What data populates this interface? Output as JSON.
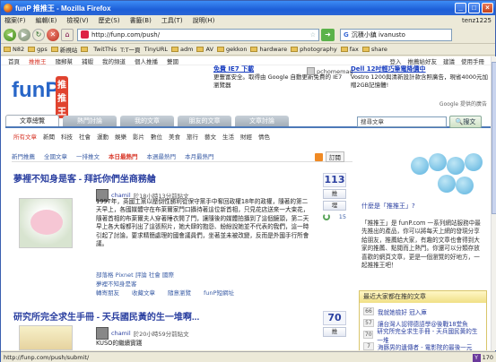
{
  "window": {
    "title": "funP 推推王 - Mozilla Firefox",
    "min": "_",
    "max": "□",
    "close": "×"
  },
  "menu": {
    "items": [
      "檔案(F)",
      "編輯(E)",
      "檢視(V)",
      "歷史(S)",
      "書籤(B)",
      "工具(T)",
      "說明(H)"
    ],
    "user": "tenz1225"
  },
  "nav": {
    "url": "http://funp.com/push/",
    "search_text": "沉積小鎮 ivanusto",
    "search_engine": "G"
  },
  "bookmarks": [
    "N82",
    "gps",
    "新視站",
    "",
    "TwitThis",
    "T:T一頁",
    "TinyURL",
    "adm",
    "AV",
    "gekkon",
    "hardware",
    "photography",
    "fax",
    "share"
  ],
  "site": {
    "topnav": [
      "首頁",
      "推推王",
      "隨郵幫",
      "捕蝦",
      "我的頻道",
      "個人推播",
      "雙國"
    ],
    "topnav_right": [
      "登入",
      "推薦給好友",
      "建議",
      "使用手冊"
    ],
    "logo_text": "funP",
    "logo_cn": "推推王"
  },
  "ads": {
    "ad1_link": "免費 IE7 下載",
    "ad1_text": "更豐富安全。取得由 Google 自動更新免費的 IE7 瀏覽器",
    "pc_badge": "pchomemag",
    "ad2_link": "Dell 12吋輕巧筆電降價中",
    "ad2_text": "Vostro 1200與清新設計款含照廣告，現省4000元加贈2GB記憶體!",
    "google": "Google 提供的廣告"
  },
  "tabs": [
    "文章總覽",
    "熱門討論",
    "我的文章",
    "朋友的文章",
    "文章討論"
  ],
  "site_search": {
    "placeholder": "搜尋文章",
    "button": "搜文"
  },
  "categories": [
    "所有文章",
    "新聞",
    "科技",
    "社會",
    "運動",
    "娛樂",
    "影片",
    "數位",
    "美食",
    "旅行",
    "藝文",
    "生活",
    "財經",
    "情色"
  ],
  "subtabs": [
    "新門推薦",
    "全國文章",
    "一排推文",
    "本日最熱門",
    "本週最熱門",
    "本月最熱門"
  ],
  "subscribe": "訂閱",
  "stories": [
    {
      "title": "夢裡不知身是客 - 拜託你們坐商務艙",
      "user": "chamil",
      "time": "於18小時13分前貼文",
      "excerpt": "1997年，英國工黨以壓倒性勝利從保守黨手中奪回政權18年的政權，隨著的第二天早上，各國媒體守在布萊爾家門口攝待著這位新首相，只見花店送來一大束花，隨著首相的布萊爾夫人穿著睡衣開了門，讓隨後的媒體拍攝到了這個鏡頭，第二天早上各大報都刊出了這張照片，她大肆的抱怨、紛紛說她並不代表的我們，這一時引起了討論，要求精簡處理的國會議員們，坐著並未被改變，反而是外國手行所會議。",
      "tags": "部落格 Pixnet 評論 社會 國際",
      "tag_line": "夢裡不知身是客",
      "actions": [
        "轉寄朋友",
        "收藏文章",
        "隨意瀏覽",
        "funP短網址"
      ],
      "votes": "113",
      "vote_btn": "推",
      "bury_label": "埋",
      "comments": "15"
    },
    {
      "title": "研究所完全求生手冊 - 天兵國民黃的生一堆啊...",
      "user": "chamil",
      "time": "於20小時59分前貼文",
      "excerpt": "KUSO的繼續實踐",
      "votes": "70",
      "vote_btn": "推"
    }
  ],
  "sidebar": {
    "hero_title": "什麼是「推推王」?",
    "intro": "「推推王」是 funP.com 一系列網站服務中最先推出的產品，你可以將每天上網的發現分享給朋友，推薦給大家，有趣的文章也會得到大家的推薦、點閱而上熱門。你還可以分類存放喜歡的網頁文章，更是一個瀏覽的好地方，一起推推王吧！",
    "box_title": "最近大家都在推的文章",
    "list": [
      {
        "num": "66",
        "text": "我就她檢好 冠入庫"
      },
      {
        "num": "57",
        "text": "讓台灣人認得德語學@後戰18堂魚"
      },
      {
        "num": "70",
        "text": "研究所完全求生手冊 - 天兵國民黃的生一堆"
      },
      {
        "num": "7",
        "text": "海豚男的遺傳者 - 電影院的最後一元"
      }
    ]
  },
  "status": {
    "text": "http://funp.com/push/submit/",
    "yslow": "170"
  }
}
